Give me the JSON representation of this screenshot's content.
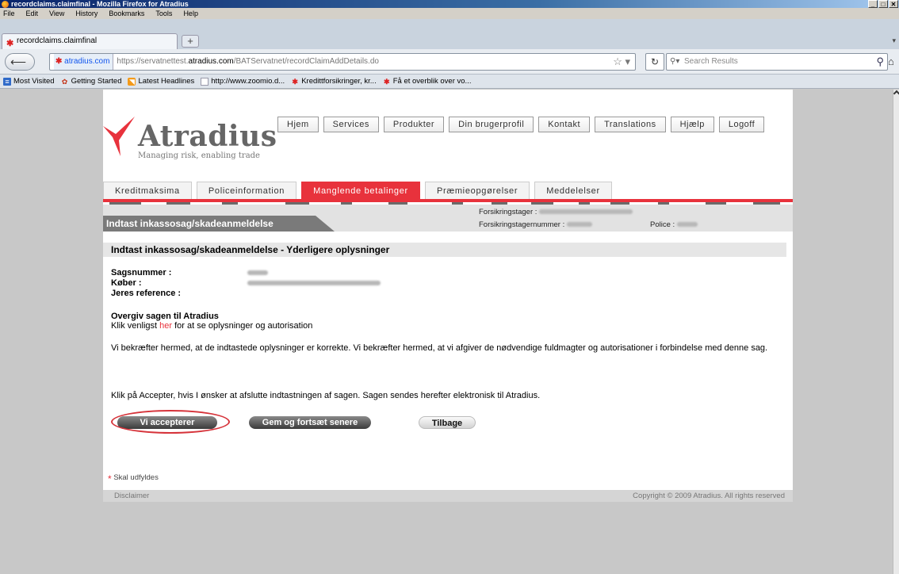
{
  "window": {
    "title": "recordclaims.claimfinal - Mozilla Firefox for Atradius",
    "buttons": [
      "_",
      "□",
      "✕"
    ]
  },
  "menu": [
    "File",
    "Edit",
    "View",
    "History",
    "Bookmarks",
    "Tools",
    "Help"
  ],
  "browser": {
    "tab_title": "recordclaims.claimfinal",
    "site_identity": "atradius.com",
    "url_prefix": "https://servatnettest.",
    "url_domain": "atradius.com",
    "url_path": "/BATServatnet/recordClaimAddDetails.do",
    "search_placeholder": "Search Results"
  },
  "bookmarks": [
    "Most Visited",
    "Getting Started",
    "Latest Headlines",
    "http://www.zoomio.d...",
    "Kredittforsikringer, kr...",
    "Få et overblik over vo..."
  ],
  "site": {
    "brand": "Atradius",
    "tagline": "Managing risk, enabling trade",
    "topnav": [
      "Hjem",
      "Services",
      "Produkter",
      "Din brugerprofil",
      "Kontakt",
      "Translations",
      "Hjælp",
      "Logoff"
    ],
    "subtabs": [
      "Kreditmaksima",
      "Policeinformation",
      "Manglende betalinger",
      "Præmieopgørelser",
      "Meddelelser"
    ],
    "active_subtab": "Manglende betalinger",
    "page_title": "Indtast inkassosag/skadeanmeldelse",
    "info": {
      "policyholder_label": "Forsikringstager :",
      "policyholder_number_label": "Forsikringstagernummer :",
      "policy_label": "Police :"
    },
    "section_title": "Indtast inkassosag/skadeanmeldelse - Yderligere oplysninger",
    "fields": [
      {
        "label": "Sagsnummer :"
      },
      {
        "label": "Køber :"
      },
      {
        "label": "Jeres reference :"
      }
    ],
    "handover_title": "Overgiv sagen til Atradius",
    "handover_pre": "Klik venligst ",
    "handover_link": "her",
    "handover_post": " for at se oplysninger og autorisation",
    "confirmation": "Vi bekræfter hermed, at de indtastede oplysninger er korrekte. Vi bekræfter hermed, at vi afgiver de nødvendige fuldmagter og autorisationer i forbindelse med denne sag.",
    "accept_instruction": "Klik på Accepter, hvis I ønsker at afslutte indtastningen af sagen. Sagen sendes herefter elektronisk til Atradius.",
    "buttons": {
      "accept": "Vi accepterer",
      "save": "Gem og fortsæt senere",
      "back": "Tilbage"
    },
    "required_note": "Skal udfyldes",
    "footer_left": "Disclaimer",
    "footer_right": "Copyright © 2009 Atradius. All rights reserved"
  },
  "colors": {
    "brand_red": "#e8323c",
    "highlight_oval": "#d6333a"
  }
}
